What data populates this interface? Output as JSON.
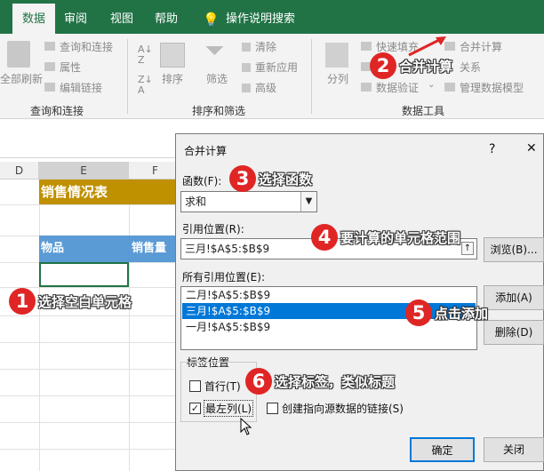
{
  "ribbon_tabs": [
    "数据",
    "审阅",
    "视图",
    "帮助",
    "操作说明搜索"
  ],
  "ribbon": {
    "refresh_all": "全部刷新",
    "queries_connections": "查询和连接",
    "properties": "属性",
    "edit_links": "编辑链接",
    "group_queries": "查询和连接",
    "sort": "排序",
    "filter": "筛选",
    "clear": "清除",
    "reapply": "重新应用",
    "advanced": "高级",
    "group_sort_filter": "排序和筛选",
    "text_to_columns": "分列",
    "flash_fill": "快速填充",
    "consolidate": "合并计算",
    "relationships": "关系",
    "data_validation": "数据验证",
    "manage_data_model": "管理数据模型",
    "group_data_tools": "数据工具"
  },
  "sheet": {
    "col_headers": [
      "D",
      "E",
      "F"
    ],
    "title": "销售情况表",
    "header_item": "物品",
    "header_sales": "销售量"
  },
  "dialog": {
    "title": "合并计算",
    "help": "?",
    "close": "✕",
    "function_label": "函数(F):",
    "function_value": "求和",
    "reference_label": "引用位置(R):",
    "reference_value": "三月!$A$5:$B$9",
    "browse": "浏览(B)...",
    "all_references_label": "所有引用位置(E):",
    "all_references": [
      "二月!$A$5:$B$9",
      "三月!$A$5:$B$9",
      "一月!$A$5:$B$9"
    ],
    "add": "添加(A)",
    "delete": "删除(D)",
    "label_position": "标签位置",
    "top_row": "首行(T)",
    "left_column": "最左列(L)",
    "create_links": "创建指向源数据的链接(S)",
    "ok": "确定",
    "close_button": "关闭"
  },
  "callouts": [
    {
      "num": "1",
      "text": "选择空白单元格"
    },
    {
      "num": "2",
      "text": "合并计算"
    },
    {
      "num": "3",
      "text": "选择函数"
    },
    {
      "num": "4",
      "text": "要计算的单元格范围"
    },
    {
      "num": "5",
      "text": "点击添加"
    },
    {
      "num": "6",
      "text": "选择标签，类似标题"
    }
  ],
  "colors": {
    "excel_green": "#217346",
    "title_fill": "#bf9000",
    "header_fill": "#5b9bd5",
    "badge_red": "#e02525",
    "selection": "#0078d7"
  }
}
